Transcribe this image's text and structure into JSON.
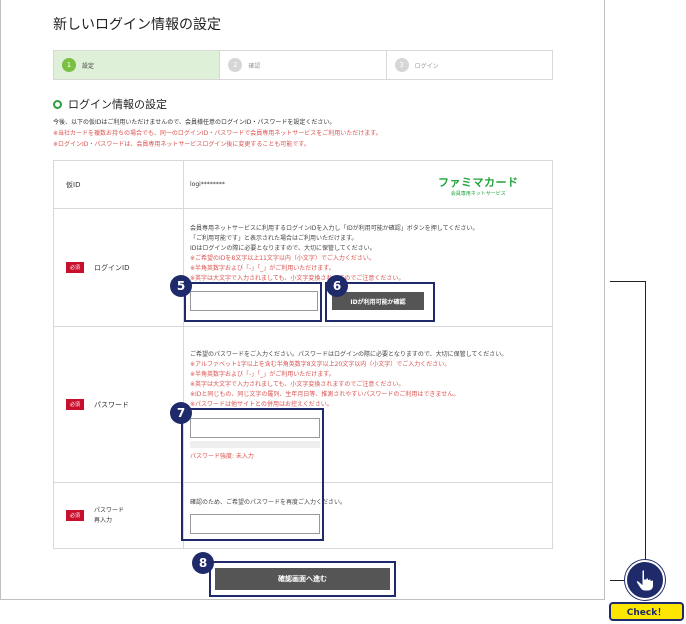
{
  "page": {
    "title": "新しいログイン情報の設定"
  },
  "steps": [
    {
      "num": "1",
      "label": "設定"
    },
    {
      "num": "2",
      "label": "確認"
    },
    {
      "num": "3",
      "label": "ログイン"
    }
  ],
  "section": {
    "title": "ログイン情報の設定",
    "intro": [
      "今後、以下の仮IDはご利用いただけませんので、会員様任意のログインID・パスワードを設定ください。",
      "※当社カードを複数お持ちの場合でも、同一のログインID・パスワードで会員専用ネットサービスをご利用いただけます。",
      "※ログインID・パスワードは、会員専用ネットサービスログイン後に変更することも可能です。"
    ]
  },
  "temp_id": {
    "label": "仮ID",
    "value": "logi********"
  },
  "logo": {
    "main": "ファミマカード",
    "sub": "会員専用ネットサービス"
  },
  "required_label": "必須",
  "login_id": {
    "label": "ログインID",
    "help": [
      "会員専用ネットサービスに利用するログインIDを入力し「IDが利用可能か確認」ボタンを押してください。",
      "「ご利用可能です」と表示された場合はご利用いただけます。",
      "IDはログインの際に必要となりますので、大切に保管してください。"
    ],
    "notes": [
      "※ご希望のIDを8文字以上11文字以内（小文字）でご入力ください。",
      "※半角英数字および「-」「_」がご利用いただけます。",
      "※英字は大文字で入力されましても、小文字変換されますのでご注意ください。"
    ],
    "value": "",
    "check_button": "IDが利用可能か確認"
  },
  "password": {
    "label": "パスワード",
    "help": "ご希望のパスワードをご入力ください。パスワードはログインの際に必要となりますので、大切に保管してください。",
    "notes": [
      "※アルファベット1字以上を含む半角英数字8文字以上20文字以内（小文字）でご入力ください。",
      "※半角英数字および「-」「_」がご利用いただけます。",
      "※英字は大文字で入力されましても、小文字変換されますのでご注意ください。",
      "※IDと同じもの、同じ文字の羅列、生年月日等、推測されやすいパスワードのご利用はできません。",
      "※パスワードは他サイトとの併用はお控えください。"
    ],
    "value": "",
    "strength": "パスワード強度: 未入力"
  },
  "password_confirm": {
    "label_line1": "パスワード",
    "label_line2": "再入力",
    "help": "確認のため、ご希望のパスワードを再度ご入力ください。",
    "value": ""
  },
  "next_button": "確認画面へ進む",
  "badges": {
    "b5": "5",
    "b6": "6",
    "b7": "7",
    "b8": "8"
  },
  "check_label": "Check！"
}
